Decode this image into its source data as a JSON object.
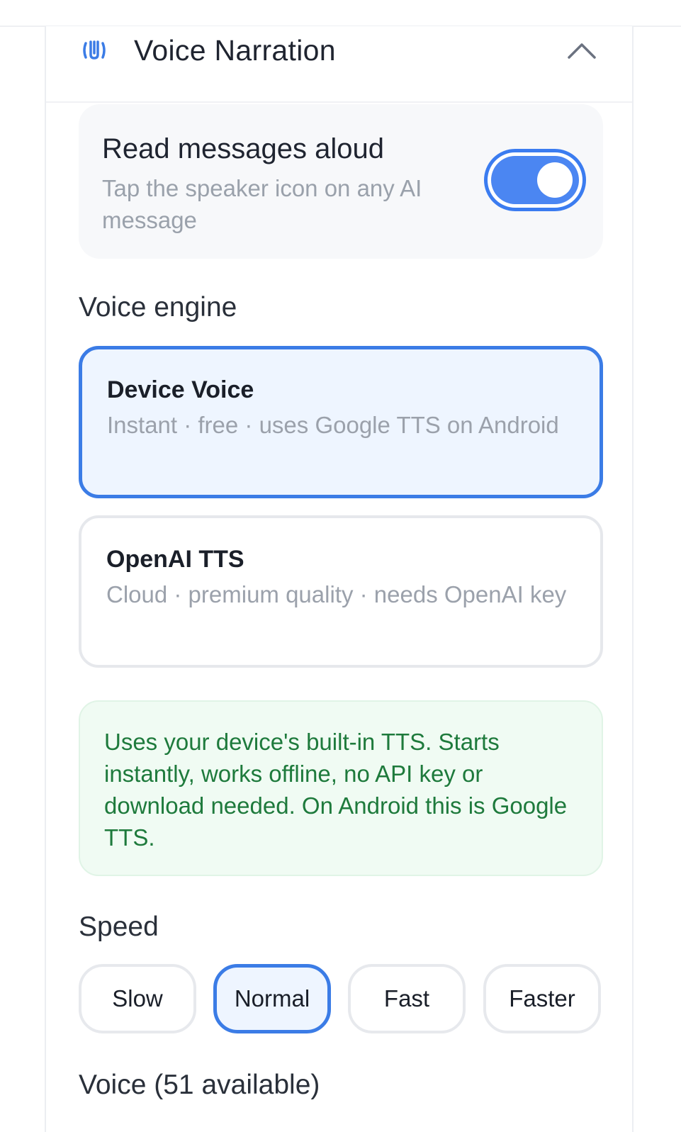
{
  "header": {
    "title": "Voice Narration",
    "icon": "sound-wave-icon",
    "collapse_icon": "chevron-up-icon",
    "accent": "#3b7ce6"
  },
  "read_aloud": {
    "title": "Read messages aloud",
    "description": "Tap the speaker icon on any AI message",
    "enabled": true
  },
  "voice_engine": {
    "label": "Voice engine",
    "options": [
      {
        "name": "Device Voice",
        "description": "Instant · free · uses Google TTS on Android",
        "selected": true
      },
      {
        "name": "OpenAI TTS",
        "description": "Cloud · premium quality · needs OpenAI key",
        "selected": false
      }
    ],
    "info": "Uses your device's built-in TTS. Starts instantly, works offline, no API key or download needed. On Android this is Google TTS."
  },
  "speed": {
    "label": "Speed",
    "options": [
      "Slow",
      "Normal",
      "Fast",
      "Faster"
    ],
    "selected": "Normal"
  },
  "voice": {
    "label": "Voice (51 available)"
  }
}
